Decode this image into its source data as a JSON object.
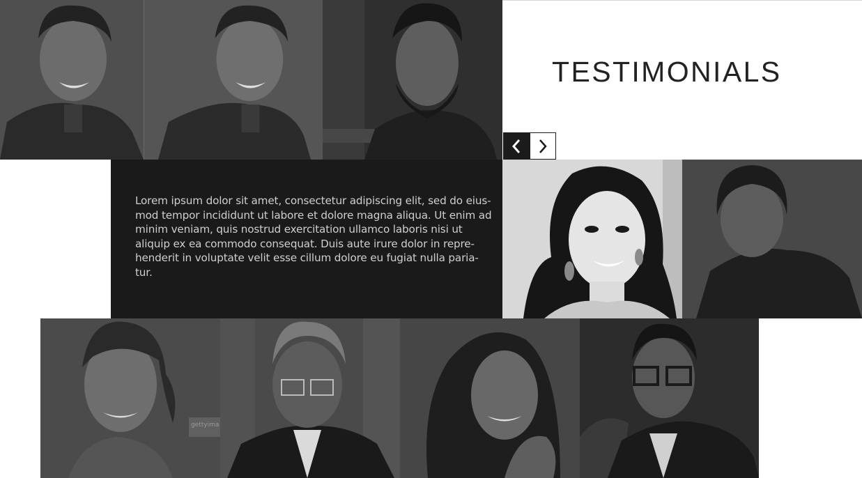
{
  "section": {
    "title": "TESTIMONIALS"
  },
  "navigation": {
    "prev_icon": "chevron-left-icon",
    "next_icon": "chevron-right-icon"
  },
  "testimonial": {
    "lines": [
      "Lorem ipsum dolor sit amet, consectetur adipiscing elit, sed do eius-",
      "mod tempor incididunt ut labore et dolore magna aliqua. Ut enim ad",
      "minim veniam, quis nostrud exercitation ullamco laboris nisi ut",
      "aliquip ex ea commodo consequat. Duis aute irure dolor in repre-",
      "henderit in voluptate velit esse cillum dolore eu fugiat nulla paria-",
      "tur."
    ]
  },
  "photos": {
    "watermark": "gettyima"
  },
  "colors": {
    "panel": "#1b1a1b",
    "text": "#cfcfcf",
    "title": "#222222",
    "nav_active": "#1b1b1b",
    "background": "#ffffff"
  }
}
